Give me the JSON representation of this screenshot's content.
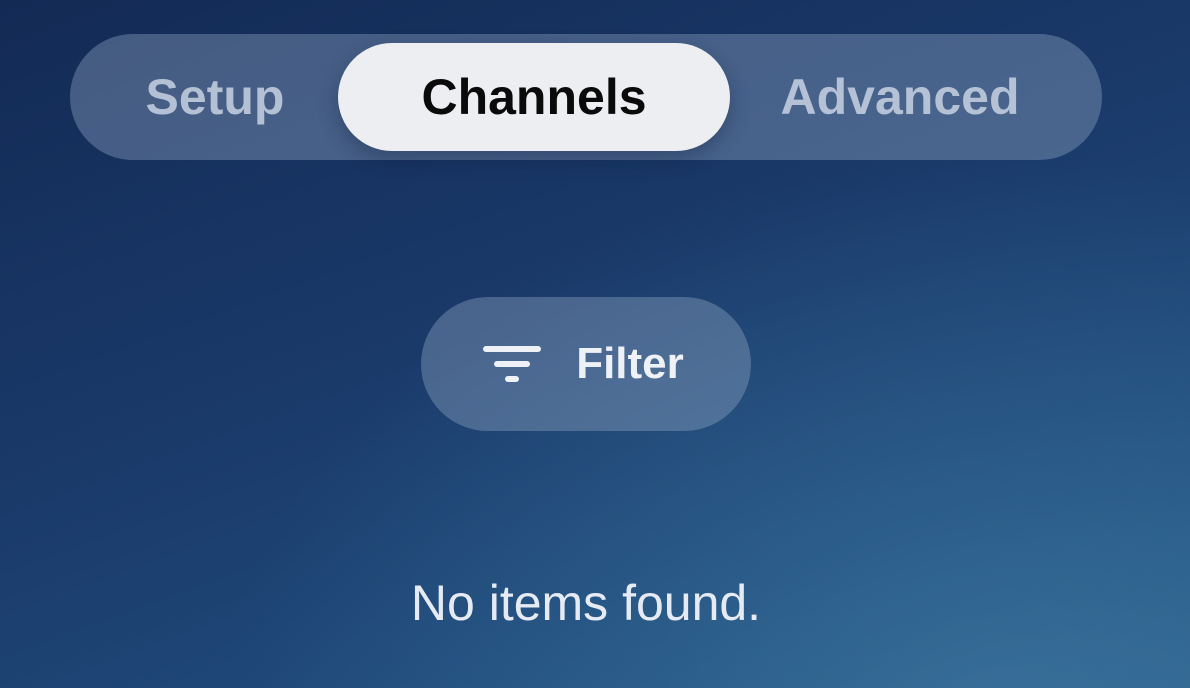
{
  "tabs": {
    "items": [
      {
        "label": "Setup",
        "active": false
      },
      {
        "label": "Channels",
        "active": true
      },
      {
        "label": "Advanced",
        "active": false
      }
    ]
  },
  "filter": {
    "label": "Filter",
    "icon": "filter-icon"
  },
  "results": {
    "empty_message": "No items found."
  },
  "colors": {
    "active_tab_bg": "#eceef2",
    "active_tab_text": "#0a0a0a",
    "inactive_tab_text": "#c9d3e2",
    "background": "#1a3a6a"
  }
}
